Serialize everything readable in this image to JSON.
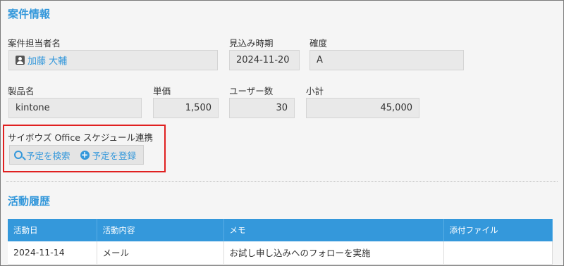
{
  "case_info": {
    "title": "案件情報",
    "owner_label": "案件担当者名",
    "owner_value": "加藤 大輔",
    "forecast_label": "見込み時期",
    "forecast_value": "2024-11-20",
    "certainty_label": "確度",
    "certainty_value": "A",
    "product_label": "製品名",
    "product_value": "kintone",
    "unit_price_label": "単価",
    "unit_price_value": "1,500",
    "users_label": "ユーザー数",
    "users_value": "30",
    "subtotal_label": "小計",
    "subtotal_value": "45,000"
  },
  "schedule": {
    "label": "サイボウズ Office スケジュール連携",
    "search_label": "予定を検索",
    "register_label": "予定を登録",
    "search_icon": "search-icon",
    "register_icon": "plus-circle-icon"
  },
  "history": {
    "title": "活動履歴",
    "columns": [
      "活動日",
      "活動内容",
      "メモ",
      "添付ファイル"
    ],
    "rows": [
      [
        "2024-11-14",
        "メール",
        "お試し申し込みへのフォローを実施",
        ""
      ]
    ]
  },
  "colors": {
    "accent": "#3498db",
    "highlight": "#e02020"
  }
}
